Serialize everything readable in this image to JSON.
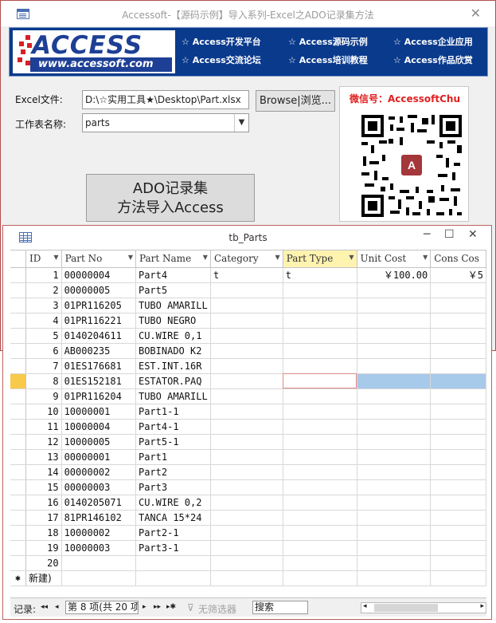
{
  "window": {
    "title": "Accessoft-【源码示例】导入系列-Excel之ADO记录集方法",
    "close_glyph": "✕"
  },
  "banner": {
    "logo_word": "ACCESS",
    "logo_url": "www.accessoft.com",
    "links": [
      "☆ Access开发平台",
      "☆ Access源码示例",
      "☆ Access企业应用",
      "☆ Access交流论坛",
      "☆ Access培训教程",
      "☆ Access作品欣赏"
    ]
  },
  "form": {
    "excel_label": "Excel文件:",
    "excel_path": "D:\\☆实用工具★\\Desktop\\Part.xlsx",
    "browse_label": "Browse|浏览...",
    "sheet_label": "工作表名称:",
    "sheet_value": "parts",
    "import_line1": "ADO记录集",
    "import_line2": "方法导入Access",
    "wechat_label": "微信号：AccessoftChu"
  },
  "datasheet": {
    "title": "tb_Parts",
    "columns": [
      "ID",
      "Part No",
      "Part Name",
      "Category",
      "Part Type",
      "Unit Cost",
      "Cons Cos"
    ],
    "rows": [
      [
        "1",
        "00000004",
        "Part4",
        "t",
        "t",
        "￥100.00",
        "￥5"
      ],
      [
        "2",
        "00000005",
        "Part5",
        "",
        "",
        "",
        ""
      ],
      [
        "3",
        "01PR116205",
        "TUBO AMARILL",
        "",
        "",
        "",
        ""
      ],
      [
        "4",
        "01PR116221",
        "TUBO NEGRO",
        "",
        "",
        "",
        ""
      ],
      [
        "5",
        "0140204611",
        "CU.WIRE 0,1",
        "",
        "",
        "",
        ""
      ],
      [
        "6",
        "AB000235",
        "BOBINADO K2",
        "",
        "",
        "",
        ""
      ],
      [
        "7",
        "01ES176681",
        "EST.INT.16R",
        "",
        "",
        "",
        ""
      ],
      [
        "8",
        "01ES152181",
        "ESTATOR.PAQ",
        "",
        "",
        "",
        ""
      ],
      [
        "9",
        "01PR116204",
        "TUBO AMARILL",
        "",
        "",
        "",
        ""
      ],
      [
        "10",
        "10000001",
        "Part1-1",
        "",
        "",
        "",
        ""
      ],
      [
        "11",
        "10000004",
        "Part4-1",
        "",
        "",
        "",
        ""
      ],
      [
        "12",
        "10000005",
        "Part5-1",
        "",
        "",
        "",
        ""
      ],
      [
        "13",
        "00000001",
        "Part1",
        "",
        "",
        "",
        ""
      ],
      [
        "14",
        "00000002",
        "Part2",
        "",
        "",
        "",
        ""
      ],
      [
        "15",
        "00000003",
        "Part3",
        "",
        "",
        "",
        ""
      ],
      [
        "16",
        "0140205071",
        "CU.WIRE 0,2",
        "",
        "",
        "",
        ""
      ],
      [
        "17",
        "81PR146102",
        "TANCA 15*24",
        "",
        "",
        "",
        ""
      ],
      [
        "18",
        "10000002",
        "Part2-1",
        "",
        "",
        "",
        ""
      ],
      [
        "19",
        "10000003",
        "Part3-1",
        "",
        "",
        "",
        ""
      ],
      [
        "20",
        "",
        "",
        "",
        "",
        "",
        ""
      ]
    ],
    "new_row_marker": "✱",
    "new_row_label": "新建)",
    "current_row": 8
  },
  "navigator": {
    "label": "记录:",
    "first": "◂◂",
    "prev": "◂",
    "record_text": "第 8 项(共 20 项",
    "next": "▸",
    "last": "▸▸",
    "new": "▸✱",
    "filter": "无筛选器",
    "search": "搜索"
  }
}
